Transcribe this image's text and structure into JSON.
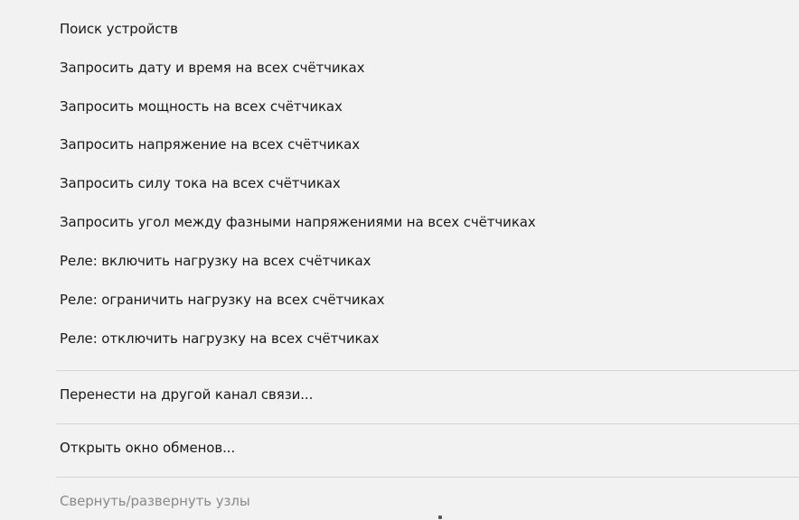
{
  "menu": {
    "items": [
      {
        "label": "Поиск устройств"
      },
      {
        "label": "Запросить дату и время на всех счётчиках"
      },
      {
        "label": "Запросить мощность на всех счётчиках"
      },
      {
        "label": "Запросить напряжение на всех счётчиках"
      },
      {
        "label": "Запросить силу тока на всех счётчиках"
      },
      {
        "label": "Запросить угол между фазными напряжениями на всех счётчиках"
      },
      {
        "label": "Реле: включить нагрузку на всех счётчиках"
      },
      {
        "label": "Реле: ограничить нагрузку на всех счётчиках"
      },
      {
        "label": "Реле: отключить нагрузку на всех счётчиках"
      },
      {
        "label": "Перенести на другой канал связи..."
      },
      {
        "label": "Открыть окно обменов..."
      },
      {
        "label": "Свернуть/развернуть узлы",
        "disabled": true
      }
    ]
  },
  "colors": {
    "background": "#f2f2f2",
    "text": "#1a1a1a",
    "disabled_text": "#8a8a8a",
    "separator": "#d4d4d4"
  }
}
